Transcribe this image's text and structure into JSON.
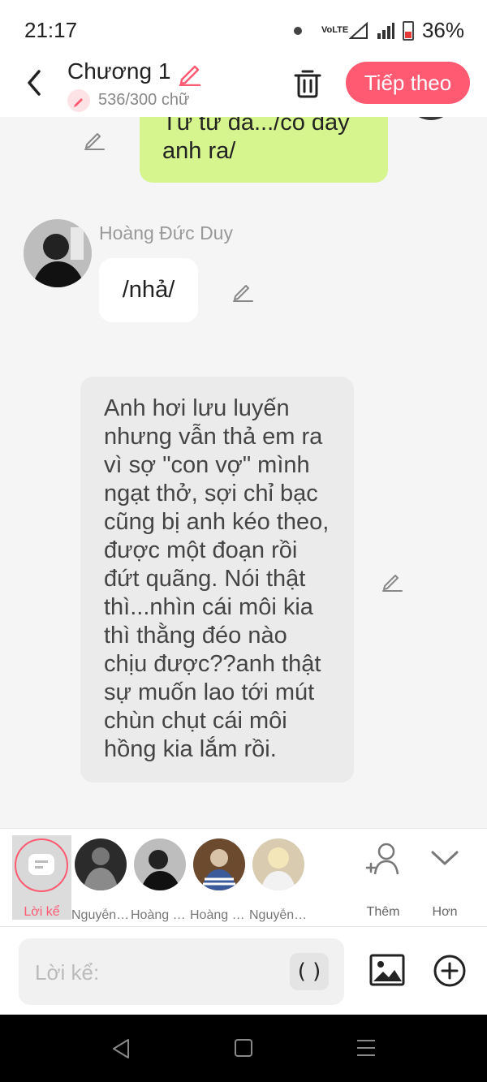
{
  "status_bar": {
    "time": "21:17",
    "network": "VoLTE",
    "battery": "36%"
  },
  "header": {
    "title": "Chương 1",
    "word_count": "536/300 chữ",
    "next_label": "Tiếp theo",
    "accent": "#ff5a72"
  },
  "chat": {
    "partial_message": {
      "line1": "Từ từ đã.../cô đầy",
      "line2": "anh ra/",
      "color": "#d6f58f"
    },
    "character_message": {
      "sender": "Hoàng Đức Duy",
      "text": "/nhả/"
    },
    "narration": {
      "lines": [
        "Anh hơi lưu luyến",
        "nhưng vẫn thả em ra",
        "vì sợ \"con vợ\" mình",
        "ngạt thở, sợi chỉ bạc",
        "cũng bị anh kéo theo,",
        "được một đoạn rồi",
        "đứt quãng. Nói thật",
        "thì...nhìn cái môi kia",
        "thì thằng đéo nào",
        "chịu được??anh thật",
        "sự muốn lao tới mút",
        "chùn chụt cái môi",
        "hồng kia lắm rồi."
      ]
    }
  },
  "characters": {
    "narrator_label": "Lời kể",
    "list": [
      {
        "name": "Nguyễn Q..."
      },
      {
        "name": "Hoàng Đứ..."
      },
      {
        "name": "Hoàng Đứ..."
      },
      {
        "name": "Nguyễn Q..."
      }
    ],
    "add_label": "Thêm",
    "more_label": "Hơn"
  },
  "input": {
    "placeholder": "Lời kể:",
    "paren_label": "( )"
  }
}
